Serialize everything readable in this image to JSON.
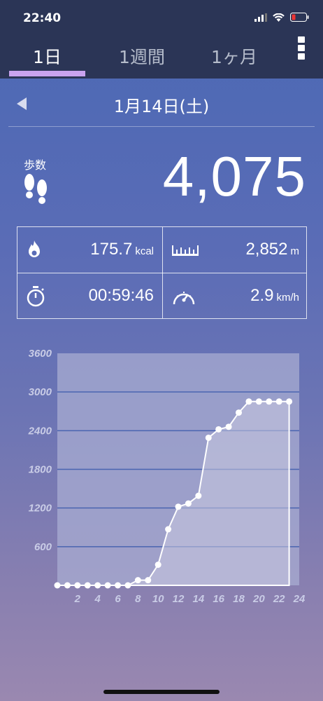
{
  "status": {
    "time": "22:40"
  },
  "tabs": [
    {
      "label": "1日"
    },
    {
      "label": "1週間"
    },
    {
      "label": "1ヶ月"
    }
  ],
  "date": {
    "label": "1月14日(土)"
  },
  "steps": {
    "label": "歩数",
    "value": "4,075"
  },
  "stats": {
    "calories": {
      "value": "175.7",
      "unit": "kcal"
    },
    "distance": {
      "value": "2,852",
      "unit": "m"
    },
    "time": {
      "value": "00:59:46"
    },
    "speed": {
      "value": "2.9",
      "unit": "km/h"
    }
  },
  "chart_data": {
    "type": "line",
    "title": "",
    "xlabel": "",
    "ylabel": "",
    "x_ticks": [
      "2",
      "4",
      "6",
      "8",
      "10",
      "12",
      "14",
      "16",
      "18",
      "20",
      "22",
      "24"
    ],
    "y_ticks": [
      "600",
      "1200",
      "1800",
      "2400",
      "3000",
      "3600"
    ],
    "xlim": [
      0,
      24
    ],
    "ylim": [
      0,
      3600
    ],
    "grid": true,
    "x": [
      0,
      1,
      2,
      3,
      4,
      5,
      6,
      7,
      8,
      9,
      10,
      11,
      12,
      13,
      14,
      15,
      16,
      17,
      18,
      19,
      20,
      21,
      22,
      23
    ],
    "values": [
      0,
      0,
      0,
      0,
      0,
      0,
      0,
      0,
      80,
      80,
      320,
      870,
      1220,
      1270,
      1390,
      2290,
      2420,
      2460,
      2680,
      2852,
      2852,
      2852,
      2852,
      2852
    ],
    "colors": {
      "line": "#ffffff",
      "fill": "#c9c9e0",
      "grid": "#4a64b0",
      "plot_bg": "#a8acd2",
      "tick_text": "#c9cce6"
    }
  }
}
